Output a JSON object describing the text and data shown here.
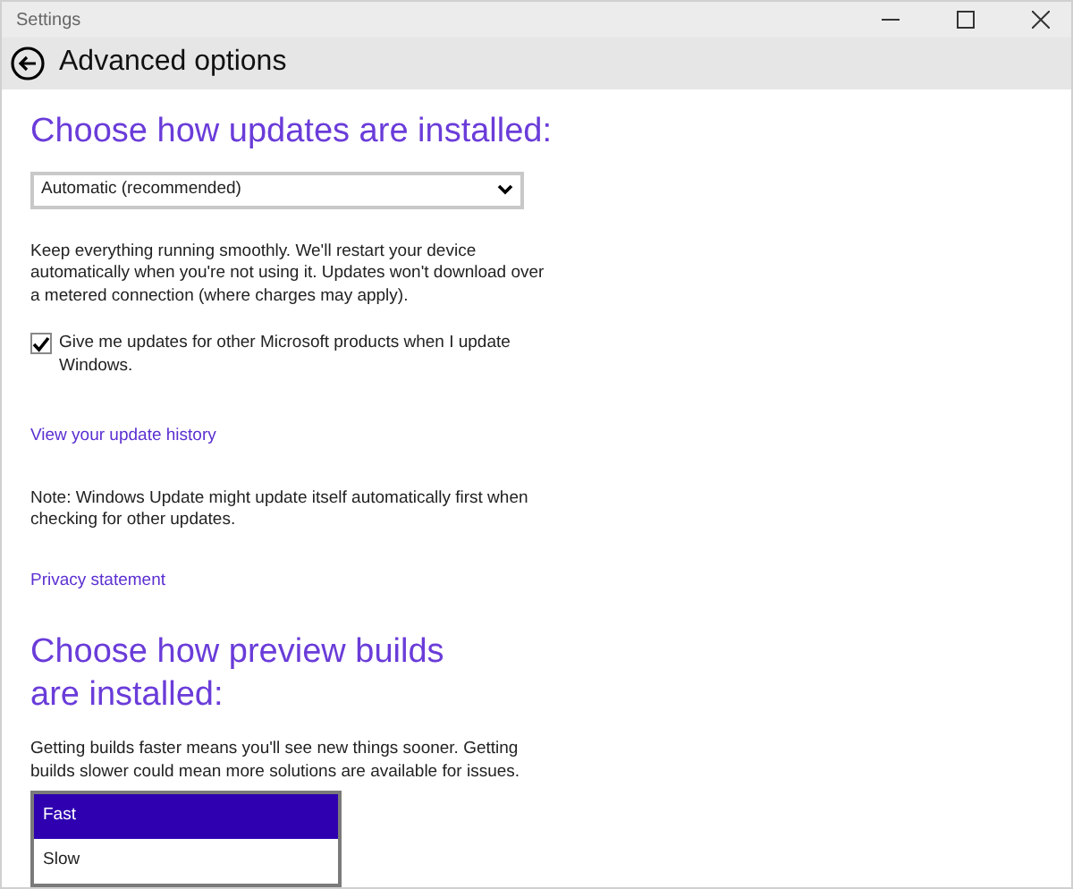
{
  "window": {
    "title": "Settings"
  },
  "header": {
    "title": "Advanced options"
  },
  "updates": {
    "heading": "Choose how updates are installed:",
    "dropdown": {
      "value": "Automatic (recommended)"
    },
    "description": "Keep everything running smoothly. We'll restart your device automatically when you're not using it. Updates won't download over a metered connection (where charges may apply).",
    "checkbox": {
      "label": "Give me updates for other Microsoft products when I update Windows.",
      "checked": true
    },
    "history_link": "View your update history",
    "note": "Note: Windows Update might update itself automatically first when checking for other updates.",
    "privacy_link": "Privacy statement"
  },
  "preview": {
    "heading": "Choose how preview builds are installed:",
    "description": "Getting builds faster means you'll see new things sooner. Getting builds slower could mean more solutions are available for issues.",
    "options": [
      {
        "label": "Fast",
        "selected": true
      },
      {
        "label": "Slow",
        "selected": false
      }
    ]
  }
}
